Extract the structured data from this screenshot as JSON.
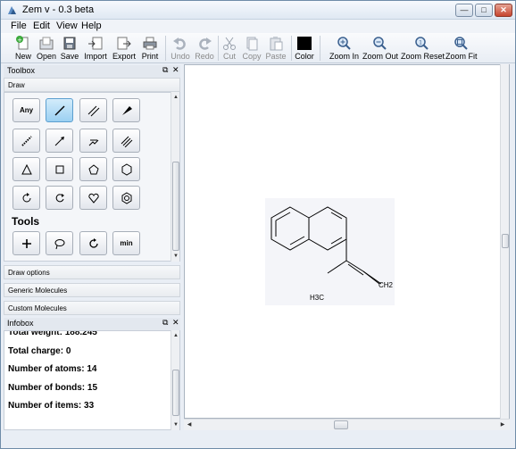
{
  "window": {
    "title": "Zem     v - 0.3 beta",
    "minimize": "—",
    "maximize": "□",
    "close": "✕"
  },
  "menubar": {
    "items": [
      "File",
      "Edit",
      "View",
      "Help"
    ]
  },
  "toolbar": {
    "new": "New",
    "open": "Open",
    "save": "Save",
    "import": "Import",
    "export": "Export",
    "print": "Print",
    "undo": "Undo",
    "redo": "Redo",
    "cut": "Cut",
    "copy": "Copy",
    "paste": "Paste",
    "color": "Color",
    "zoom_in": "Zoom In",
    "zoom_out": "Zoom Out",
    "zoom_reset": "Zoom Reset",
    "zoom_fit": "Zoom Fit"
  },
  "toolbox": {
    "title": "Toolbox",
    "draw_header": "Draw",
    "any_label": "Any",
    "tools_heading": "Tools",
    "min_label": "min",
    "sections": [
      "Draw options",
      "Generic Molecules",
      "Custom Molecules"
    ]
  },
  "infobox": {
    "title": "Infobox",
    "lines": [
      "Total weight: 188.245",
      "Total charge: 0",
      "Number of atoms: 14",
      "Number of bonds: 15",
      "Number of items: 33"
    ]
  },
  "molecule": {
    "label_left": "H3C",
    "label_right": "CH2"
  },
  "colors": {
    "accent": "#5c9fcf",
    "active_tool": "#9bd0f2",
    "color_swatch": "#000000"
  }
}
